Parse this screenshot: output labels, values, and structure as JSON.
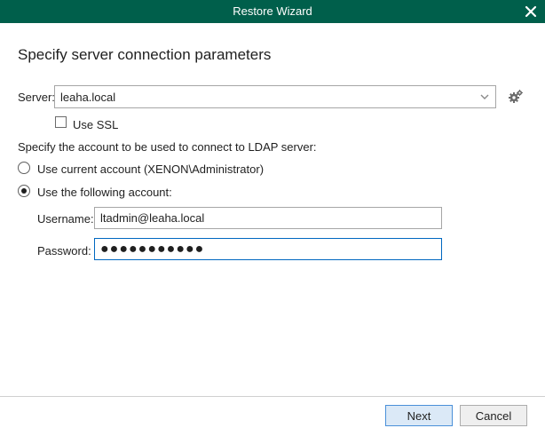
{
  "window": {
    "title": "Restore Wizard"
  },
  "page": {
    "heading": "Specify server connection parameters"
  },
  "server": {
    "label": "Server:",
    "value": "leaha.local"
  },
  "ssl": {
    "label": "Use SSL",
    "checked": false
  },
  "account": {
    "prompt": "Specify the account to be used to connect to LDAP server:",
    "option_current": "Use current account (XENON\\Administrator)",
    "option_following": "Use the following account:",
    "selected": "following"
  },
  "credentials": {
    "username_label": "Username:",
    "username_value": "ltadmin@leaha.local",
    "password_label": "Password:",
    "password_value": "●●●●●●●●●●●"
  },
  "buttons": {
    "next": "Next",
    "cancel": "Cancel"
  },
  "colors": {
    "titlebar": "#005f4b",
    "focus_border": "#0067c0",
    "primary_button": "#dbe9f7"
  }
}
